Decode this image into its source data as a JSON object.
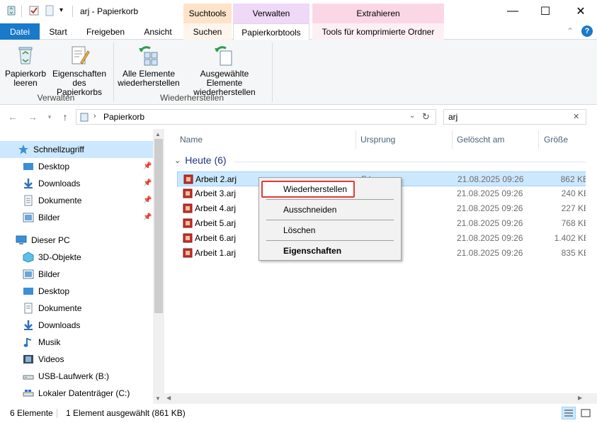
{
  "window": {
    "title": "arj - Papierkorb",
    "minimize_glyph": "—",
    "maximize_glyph": "☐",
    "close_glyph": "✕"
  },
  "contextual_tabs": {
    "suchtools": "Suchtools",
    "verwalten": "Verwalten",
    "extrahieren": "Extrahieren",
    "colors": {
      "suchtools": "#fde3c9",
      "verwalten": "#f0d8f8",
      "extrahieren": "#fbd7e6"
    }
  },
  "ribbon_tabs": [
    {
      "label": "Datei"
    },
    {
      "label": "Start"
    },
    {
      "label": "Freigeben"
    },
    {
      "label": "Ansicht"
    },
    {
      "label": "Suchen"
    },
    {
      "label": "Papierkorbtools"
    },
    {
      "label": "Tools für komprimierte Ordner"
    }
  ],
  "ribbon": {
    "buttons": [
      {
        "label_line1": "Papierkorb",
        "label_line2": "leeren",
        "icon": "recycle-bin-empty-icon"
      },
      {
        "label_line1": "Eigenschaften",
        "label_line2": "des Papierkorbs",
        "icon": "properties-icon"
      },
      {
        "label_line1": "Alle Elemente",
        "label_line2": "wiederherstellen",
        "icon": "restore-all-icon"
      },
      {
        "label_line1": "Ausgewählte Elemente",
        "label_line2": "wiederherstellen",
        "icon": "restore-selected-icon"
      }
    ],
    "groups": {
      "verwalten": "Verwalten",
      "wiederherstellen": "Wiederherstellen"
    }
  },
  "address": {
    "path": "Papierkorb",
    "search_value": "arj"
  },
  "nav": {
    "quick_access": "Schnellzugriff",
    "quick_items": [
      "Desktop",
      "Downloads",
      "Dokumente",
      "Bilder"
    ],
    "this_pc": "Dieser PC",
    "pc_items": [
      "3D-Objekte",
      "Bilder",
      "Desktop",
      "Dokumente",
      "Downloads",
      "Musik",
      "Videos",
      "USB-Laufwerk (B:)",
      "Lokaler Datenträger (C:)"
    ]
  },
  "columns": {
    "name": "Name",
    "origin": "Ursprung",
    "deleted": "Gelöscht am",
    "size": "Größe"
  },
  "group": {
    "label": "Heute (6)"
  },
  "files": [
    {
      "name": "Arbeit 2.arj",
      "origin": "E:\\",
      "deleted": "21.08.2025 09:26",
      "size": "862 KB"
    },
    {
      "name": "Arbeit 3.arj",
      "origin": "",
      "deleted": "21.08.2025 09:26",
      "size": "240 KB"
    },
    {
      "name": "Arbeit 4.arj",
      "origin": "",
      "deleted": "21.08.2025 09:26",
      "size": "227 KB"
    },
    {
      "name": "Arbeit 5.arj",
      "origin": "",
      "deleted": "21.08.2025 09:26",
      "size": "768 KB"
    },
    {
      "name": "Arbeit 6.arj",
      "origin": "",
      "deleted": "21.08.2025 09:26",
      "size": "1.402 KB"
    },
    {
      "name": "Arbeit 1.arj",
      "origin": "",
      "deleted": "21.08.2025 09:26",
      "size": "835 KB"
    }
  ],
  "context_menu": {
    "restore": "Wiederherstellen",
    "cut": "Ausschneiden",
    "delete": "Löschen",
    "properties": "Eigenschaften"
  },
  "status": {
    "count": "6 Elemente",
    "selection": "1 Element ausgewählt (861 KB)"
  }
}
